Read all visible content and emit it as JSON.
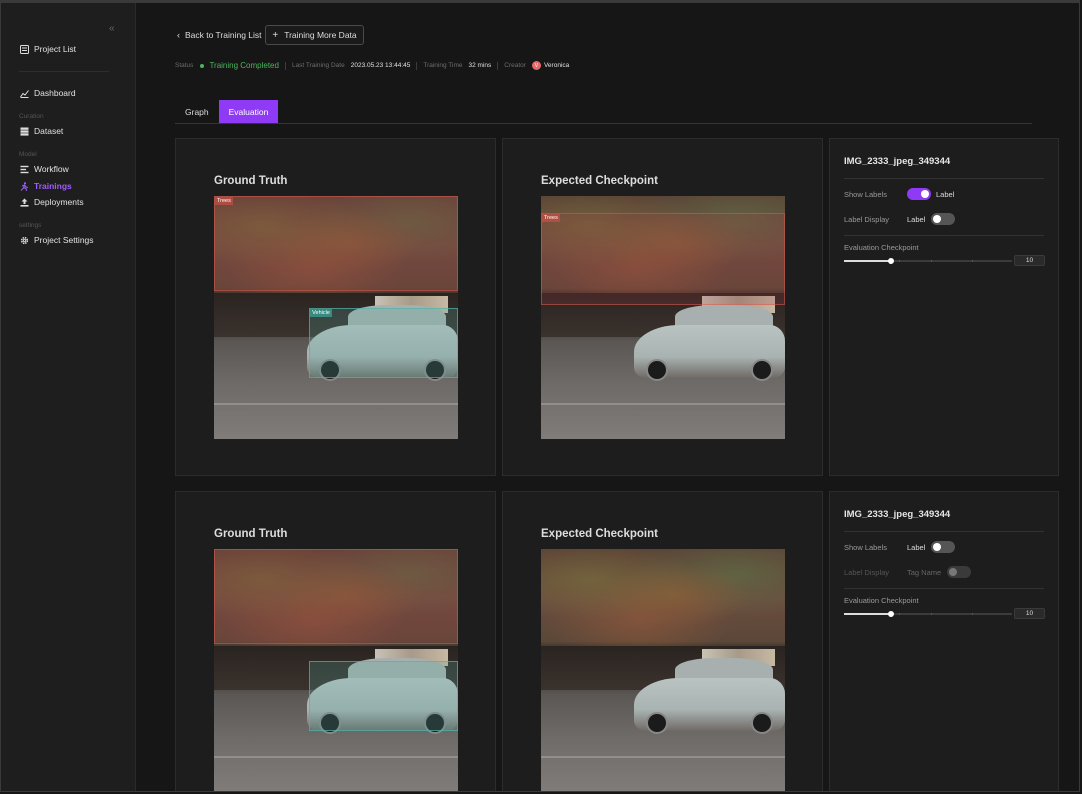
{
  "sidebar": {
    "collapse_icon": "«",
    "items": [
      {
        "label": "Project List"
      },
      {
        "label": "Dashboard"
      },
      {
        "label": "Dataset"
      },
      {
        "label": "Workflow"
      },
      {
        "label": "Trainings"
      },
      {
        "label": "Deployments"
      },
      {
        "label": "Project Settings"
      }
    ],
    "sections": {
      "curation": "Curation",
      "model": "Model",
      "settings": "settings"
    },
    "active_color": "#a05cff"
  },
  "header": {
    "back_label": "Back to Training List",
    "more_button_label": "Training More Data"
  },
  "status": {
    "status_label": "Status",
    "status_value": "Training Completed",
    "last_date_label": "Last Training Date",
    "last_date_value": "2023.05.23 13:44:45",
    "time_label": "Training Time",
    "time_value": "32 mins",
    "creator_label": "Creator",
    "creator_initials": "V",
    "creator_value": "Veronica",
    "status_color": "#4cb45d"
  },
  "tabs": [
    {
      "label": "Graph"
    },
    {
      "label": "Evaluation"
    }
  ],
  "accent_color": "#8f3bf5",
  "rows": [
    {
      "ground_truth_title": "Ground Truth",
      "expected_title": "Expected Checkpoint",
      "gt_labels": {
        "trees": "Trees",
        "vehicle": "Vehicle"
      },
      "exp_labels": {
        "trees": "Trees"
      },
      "side": {
        "image_name": "IMG_2333_jpeg_349344",
        "show_labels_label": "Show Labels",
        "show_labels_value": "Label",
        "show_labels_on": true,
        "label_display_label": "Label Display",
        "label_display_value": "Label",
        "checkpoint_label": "Evaluation Checkpoint",
        "checkpoint_value": "10",
        "checkpoint_fraction": 0.28
      }
    },
    {
      "ground_truth_title": "Ground Truth",
      "expected_title": "Expected Checkpoint",
      "side": {
        "image_name": "IMG_2333_jpeg_349344",
        "show_labels_label": "Show Labels",
        "show_labels_value": "Label",
        "show_labels_on": false,
        "label_display_label": "Label Display",
        "label_display_value": "Tag Name",
        "checkpoint_label": "Evaluation Checkpoint",
        "checkpoint_value": "10",
        "checkpoint_fraction": 0.28
      }
    }
  ]
}
